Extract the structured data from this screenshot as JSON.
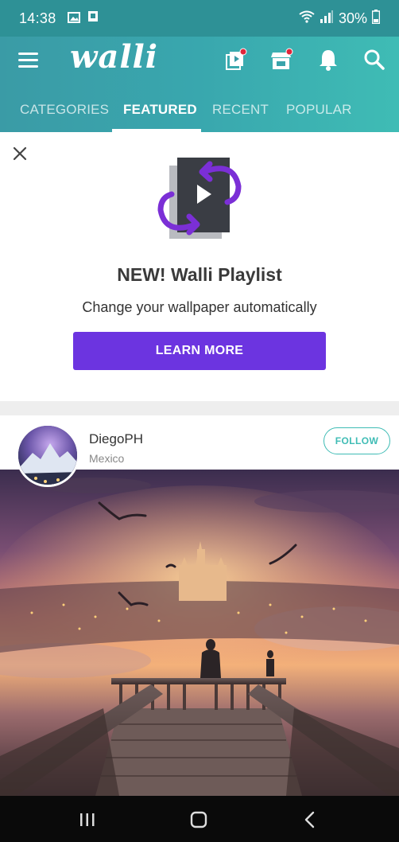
{
  "status_bar": {
    "time": "14:38",
    "battery": "30%",
    "icons": [
      "gallery-icon",
      "app-notification-icon",
      "wifi-icon",
      "signal-icon",
      "battery-icon"
    ]
  },
  "app_bar": {
    "logo": "walli",
    "icons": [
      "menu-icon",
      "playlist-icon",
      "shop-icon",
      "bell-icon",
      "search-icon"
    ],
    "accent_color": "#3fbcb5",
    "badge_color": "#e0263b"
  },
  "tabs": [
    {
      "label": "CATEGORIES"
    },
    {
      "label": "FEATURED",
      "active": true
    },
    {
      "label": "RECENT"
    },
    {
      "label": "POPULAR"
    }
  ],
  "promo": {
    "title": "NEW! Walli Playlist",
    "subtitle": "Change your wallpaper automatically",
    "button_label": "LEARN MORE",
    "button_color": "#6c34e0"
  },
  "feed": {
    "author_name": "DiegoPH",
    "author_location": "Mexico",
    "follow_label": "FOLLOW"
  },
  "nav_bar": {
    "icons": [
      "recents-icon",
      "home-icon",
      "back-icon"
    ]
  }
}
